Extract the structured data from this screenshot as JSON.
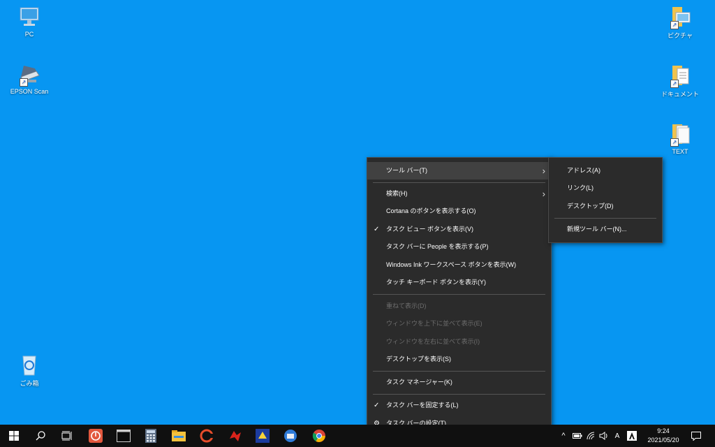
{
  "desktop": {
    "icons_left": [
      {
        "label": "PC",
        "icon": "pc-icon"
      },
      {
        "label": "EPSON Scan",
        "icon": "scanner-icon"
      },
      {
        "label": "ごみ箱",
        "icon": "recycle-bin-icon"
      }
    ],
    "icons_right": [
      {
        "label": "ピクチャ",
        "icon": "pictures-folder-icon"
      },
      {
        "label": "ドキュメント",
        "icon": "documents-folder-icon"
      },
      {
        "label": "TEXT",
        "icon": "text-folder-icon"
      }
    ]
  },
  "context_menu": {
    "items": [
      {
        "label": "ツール バー(T)",
        "has_submenu": true,
        "highlighted": true
      },
      {
        "label": "検索(H)",
        "has_submenu": true
      },
      {
        "label": "Cortana のボタンを表示する(O)"
      },
      {
        "label": "タスク ビュー ボタンを表示(V)",
        "checked": true
      },
      {
        "label": "タスク バーに People を表示する(P)"
      },
      {
        "label": "Windows Ink ワークスペース ボタンを表示(W)"
      },
      {
        "label": "タッチ キーボード ボタンを表示(Y)"
      },
      {
        "label": "重ねて表示(D)",
        "disabled": true
      },
      {
        "label": "ウィンドウを上下に並べて表示(E)",
        "disabled": true
      },
      {
        "label": "ウィンドウを左右に並べて表示(I)",
        "disabled": true
      },
      {
        "label": "デスクトップを表示(S)"
      },
      {
        "label": "タスク マネージャー(K)"
      },
      {
        "label": "タスク バーを固定する(L)",
        "checked": true
      },
      {
        "label": "タスク バーの設定(T)",
        "icon": "gear-icon"
      }
    ],
    "check_glyph": "✓",
    "gear_glyph": "⚙",
    "arrow_glyph": "›"
  },
  "toolbar_submenu": {
    "items": [
      {
        "label": "アドレス(A)"
      },
      {
        "label": "リンク(L)"
      },
      {
        "label": "デスクトップ(D)"
      },
      {
        "label": "新規ツール バー(N)..."
      }
    ]
  },
  "taskbar": {
    "time": "9:24",
    "date": "2021/05/20",
    "ime_label": "A",
    "chevron_glyph": "^",
    "pinned_apps": [
      "start",
      "search",
      "task-view",
      "avast",
      "terminal",
      "calculator",
      "file-explorer",
      "ccleaner",
      "red-app",
      "blue-app",
      "thunderbird",
      "chrome"
    ]
  },
  "colors": {
    "desktop": "#0796f2",
    "menu_bg": "#2b2b2b",
    "taskbar_bg": "#101010"
  }
}
